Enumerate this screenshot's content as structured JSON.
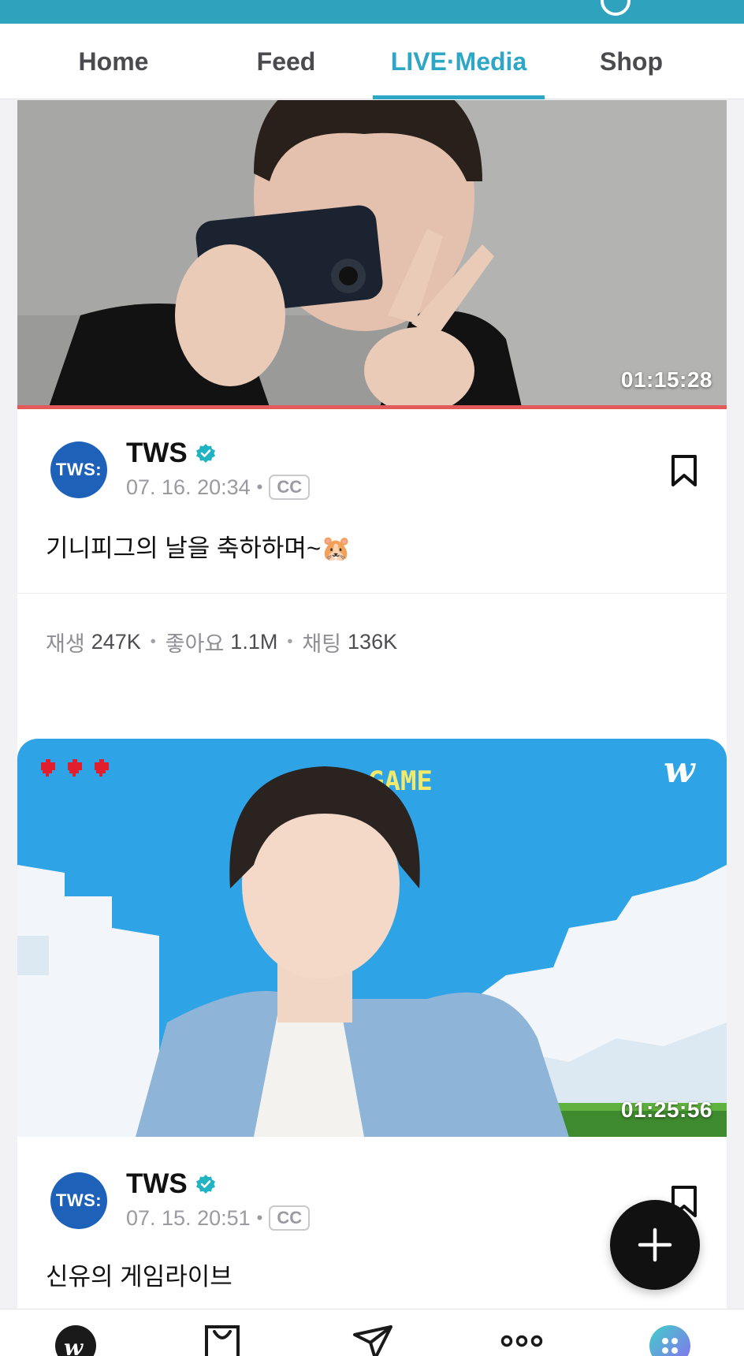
{
  "tabs": [
    {
      "label": "Home"
    },
    {
      "label": "Feed"
    },
    {
      "label": "LIVE·Media",
      "active": true
    },
    {
      "label": "Shop"
    }
  ],
  "posts": [
    {
      "duration": "01:15:28",
      "avatar_text": "TWS:",
      "author": "TWS",
      "date": "07. 16. 20:34",
      "cc": "CC",
      "title": "기니피그의 날을 축하하며~🐹",
      "stats": {
        "plays_label": "재생",
        "plays": "247K",
        "likes_label": "좋아요",
        "likes": "1.1M",
        "chats_label": "채팅",
        "chats": "136K"
      }
    },
    {
      "duration": "01:25:56",
      "avatar_text": "TWS:",
      "author": "TWS",
      "date": "07. 15. 20:51",
      "cc": "CC",
      "title": "신유의 게임라이브",
      "thumb_banner": "GAME",
      "thumb_logo": "w"
    }
  ],
  "colors": {
    "accent": "#2ea6c5",
    "progress": "#e35a5a",
    "avatar": "#1d62b8",
    "verified": "#1fb3c4"
  },
  "bottom_nav": [
    {
      "icon": "weverse-home-icon"
    },
    {
      "icon": "shop-bag-icon"
    },
    {
      "icon": "send-icon"
    },
    {
      "icon": "more-icon"
    },
    {
      "icon": "apps-icon"
    }
  ]
}
